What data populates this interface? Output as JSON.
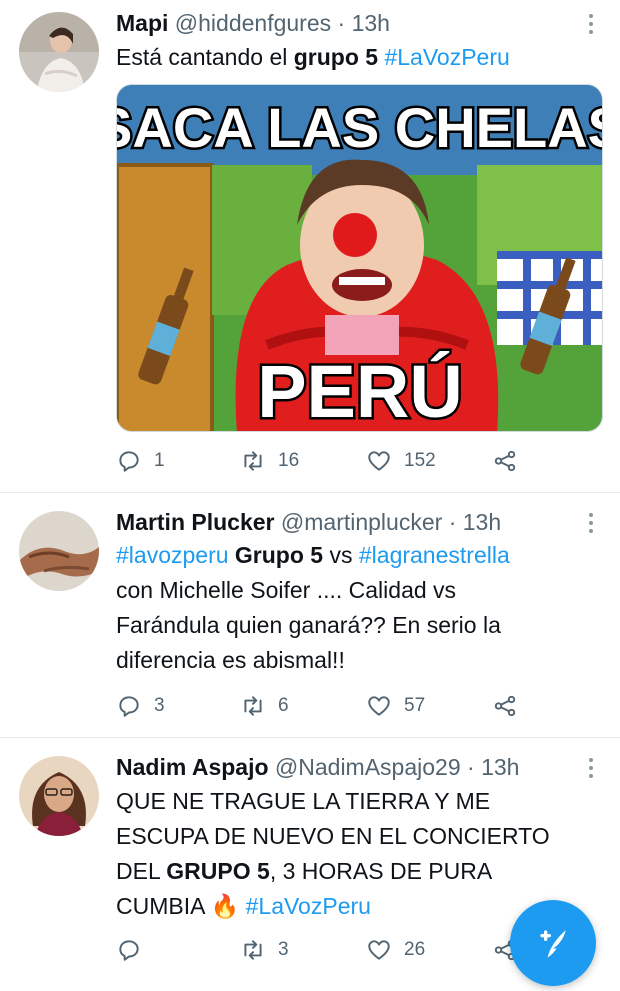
{
  "tweets": [
    {
      "name": "Mapi",
      "handle": "@hiddenfgures",
      "dot": "·",
      "time": "13h",
      "text_parts": [
        "Está cantando el ",
        "grupo 5",
        " ",
        "#LaVozPeru"
      ],
      "media": {
        "top_caption": "SACA LAS CHELAS",
        "bottom_caption": "PERÚ"
      },
      "replies": "1",
      "retweets": "16",
      "likes": "152"
    },
    {
      "name": "Martin Plucker",
      "handle": "@martinplucker",
      "dot": "·",
      "time": "13h",
      "text_parts": [
        "#lavozperu",
        " ",
        "Grupo 5",
        " vs ",
        "#lagranestrella",
        "con Michelle Soifer .... Calidad vs",
        "Farándula quien ganará?? En serio la",
        "diferencia es abismal!!"
      ],
      "replies": "3",
      "retweets": "6",
      "likes": "57"
    },
    {
      "name": "Nadim Aspajo",
      "handle": "@NadimAspajo29",
      "dot": "·",
      "time": "13h",
      "text_parts": [
        "QUE NE TRAGUE LA TIERRA Y ME",
        "ESCUPA DE NUEVO EN EL CONCIERTO",
        "DEL ",
        "GRUPO 5",
        ", 3 HORAS DE PURA",
        "CUMBIA ",
        "🔥",
        " ",
        "#LaVozPeru"
      ],
      "replies": "",
      "retweets": "3",
      "likes": "26"
    }
  ],
  "colors": {
    "accent": "#1d9bf0",
    "secondary_text": "#536471",
    "primary_text": "#0f1419"
  },
  "icons": [
    "reply-icon",
    "retweet-icon",
    "like-icon",
    "share-icon",
    "more-icon",
    "compose-icon"
  ]
}
